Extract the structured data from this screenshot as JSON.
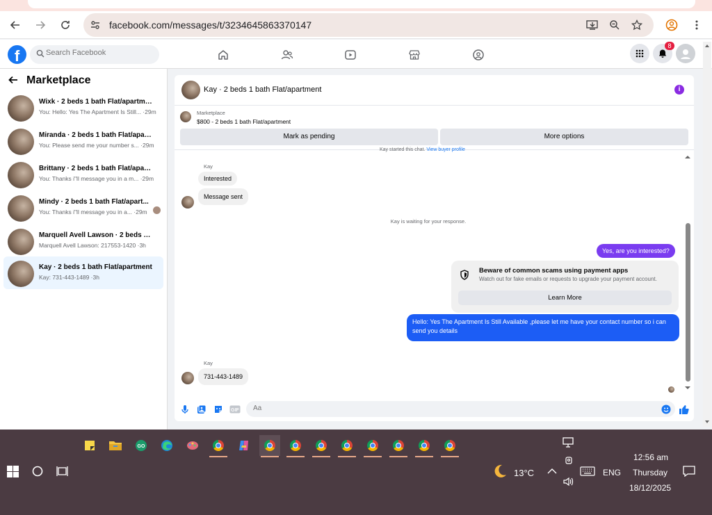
{
  "browser": {
    "url": "facebook.com/messages/t/3234645863370147",
    "icons": [
      "back-icon",
      "forward-icon",
      "reload-icon",
      "site-settings-icon",
      "install-icon",
      "zoom-icon",
      "star-icon",
      "profile-icon",
      "menu-icon"
    ]
  },
  "fb": {
    "search_placeholder": "Search Facebook",
    "notification_count": "8",
    "nav_icons": [
      "home-icon",
      "friends-icon",
      "video-icon",
      "marketplace-icon",
      "groups-icon"
    ]
  },
  "sidebar": {
    "title": "Marketplace",
    "conversations": [
      {
        "title": "Wixk · 2 beds 1 bath Flat/apartment",
        "snippet": "You: Hello: Yes The Apartment Is Still... ·29m"
      },
      {
        "title": "Miranda · 2 beds 1 bath Flat/apart...",
        "snippet": "You: Please send me your number s... ·29m"
      },
      {
        "title": "Brittany · 2 beds 1 bath Flat/apart...",
        "snippet": "You: Thanks i\"ll message you in a m... ·29m"
      },
      {
        "title": "Mindy · 2 beds 1 bath Flat/apart...",
        "snippet": "You: Thanks i\"ll message you in a... ·29m"
      },
      {
        "title": "Marquell Avell Lawson · 2 beds 1 b...",
        "snippet": "Marquell Avell Lawson: 217553-1420 ·3h"
      },
      {
        "title": "Kay · 2 beds 1 bath Flat/apartment",
        "snippet": "Kay: 731-443-1489 ·3h"
      }
    ]
  },
  "chat": {
    "title": "Kay · 2 beds 1 bath Flat/apartment",
    "marketplace_label": "Marketplace",
    "listing": "$800 - 2 beds 1 bath Flat/apartment",
    "mark_pending": "Mark as pending",
    "more_options": "More options",
    "started_text": "Kay started this chat.",
    "view_profile": "View buyer profile",
    "sender_name": "Kay",
    "msg_interested": "Interested",
    "msg_sent": "Message sent",
    "waiting": "Kay is waiting for your response.",
    "out_1": "Yes, are you interested?",
    "scam_title": "Beware of common scams using payment apps",
    "scam_text": "Watch out for fake emails or requests to upgrade your payment account.",
    "learn_more": "Learn More",
    "out_2": "Hello: Yes The Apartment Is Still Available ,please let me have your contact number so i can send you details",
    "msg_phone": "731-443-1489",
    "composer_placeholder": "Aa",
    "colors": {
      "outgoing": "#1877f2",
      "outgoing_alt": "#7a3cf0",
      "accent": "#8a2be2"
    }
  },
  "taskbar": {
    "weather": "13°C",
    "language": "ENG",
    "time": "12:56 am",
    "day": "Thursday",
    "date": "18/12/2025"
  }
}
